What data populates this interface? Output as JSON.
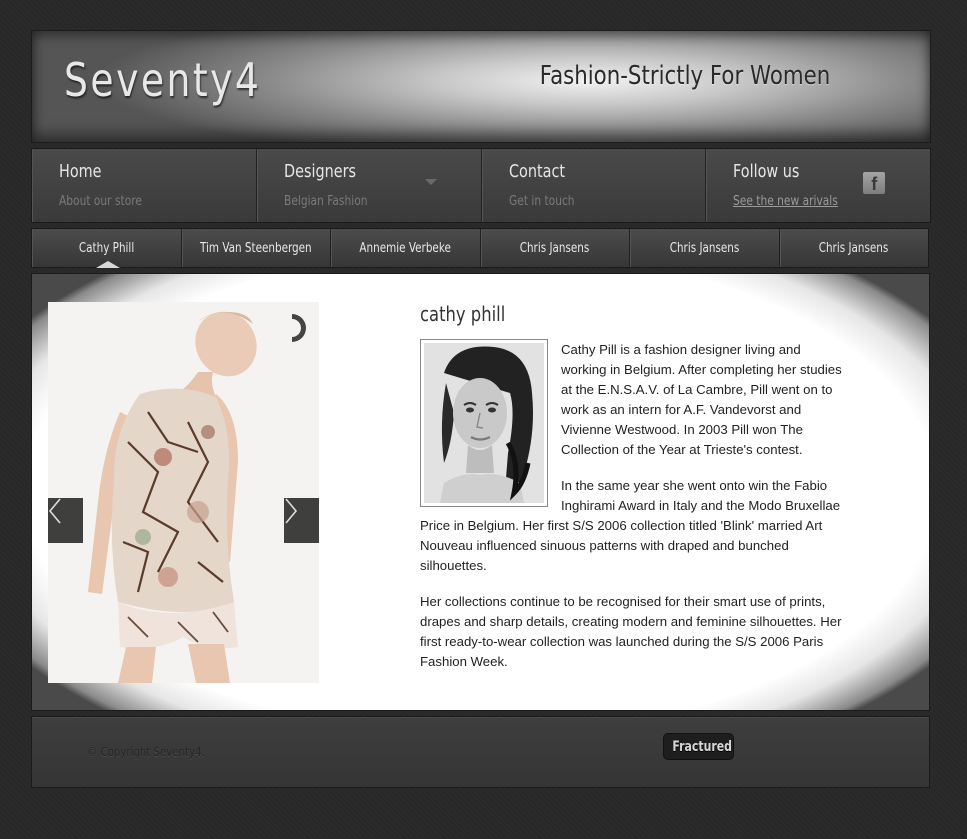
{
  "header": {
    "logo": "Seventy4",
    "tagline": "Fashion-Strictly For Women"
  },
  "nav": [
    {
      "title": "Home",
      "subtitle": "About our store"
    },
    {
      "title": "Designers",
      "subtitle": "Belgian Fashion"
    },
    {
      "title": "Contact",
      "subtitle": "Get in touch"
    },
    {
      "title": "Follow us",
      "subtitle": "See the new arivals"
    }
  ],
  "tabs": [
    "Cathy Phill",
    "Tim Van Steenbergen",
    "Annemie Verbeke",
    "Chris Jansens",
    "Chris Jansens",
    "Chris Jansens"
  ],
  "icons": {
    "facebook": "facebook-icon",
    "dropdown": "chevron-down-icon",
    "prev": "chevron-left-icon",
    "next": "chevron-right-icon",
    "loader": "loading-spinner-icon"
  },
  "content": {
    "name": "cathy phill",
    "paragraphs": [
      "Cathy Pill is a fashion designer living and working in Belgium. After completing her studies at the E.N.S.A.V. of La Cambre, Pill went on to work as an intern for A.F. Vandevorst and Vivienne Westwood. In 2003 Pill won The Collection of the Year at Trieste's contest.",
      "In the same year she went onto win the Fabio Inghirami Award in Italy and the Modo Bruxellae Price in Belgium. Her first S/S 2006 collection titled 'Blink' married Art Nouveau influenced sinuous patterns with draped and bunched silhouettes.",
      "Her collections continue to be recognised for their smart use of prints, drapes and sharp details, creating modern and feminine silhouettes. Her first ready-to-wear collection was launched during the S/S 2006 Paris Fashion Week."
    ]
  },
  "footer": {
    "copyright": "© Copyright Seventy4.",
    "badge": "Fractured"
  },
  "colors": {
    "background": "#2a2a2a",
    "nav": "#404040",
    "text": "#222222"
  }
}
